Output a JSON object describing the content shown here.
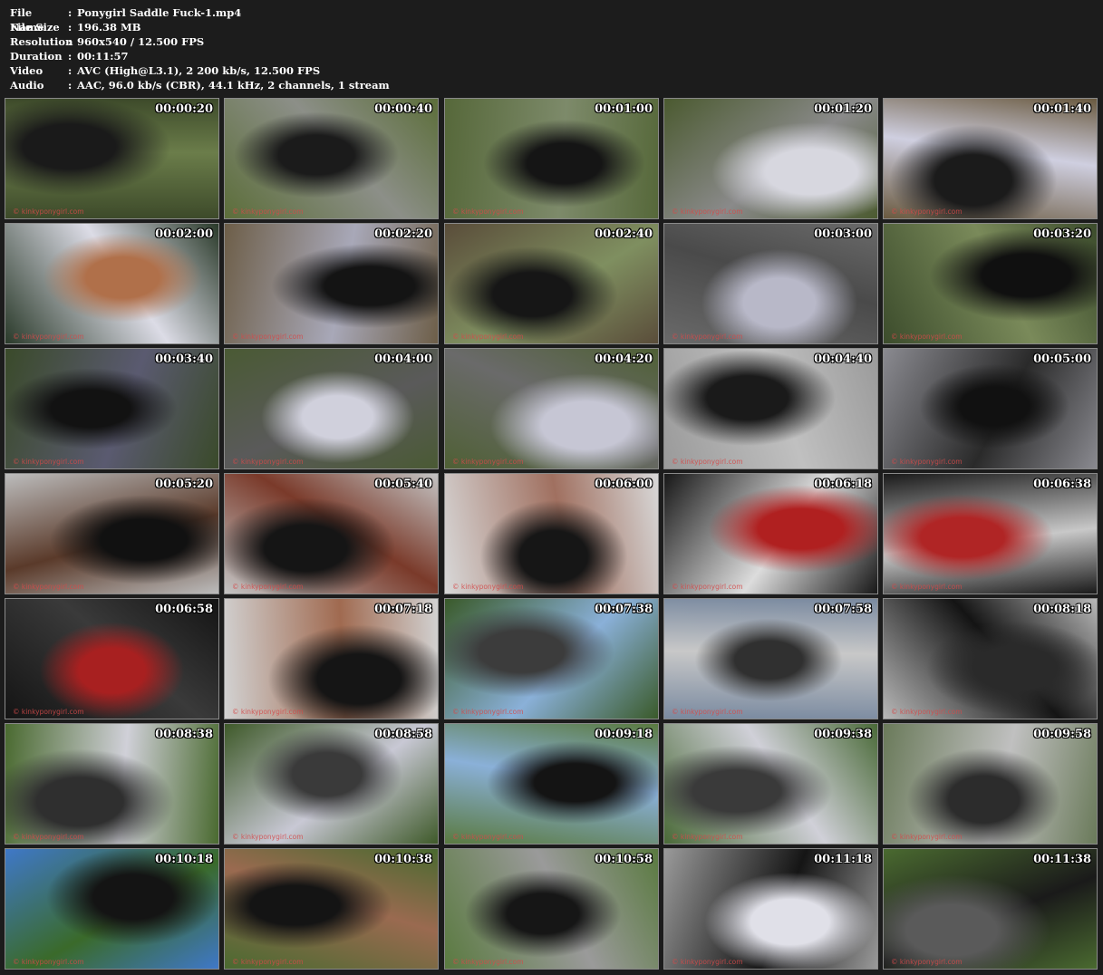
{
  "file_info": {
    "rows": [
      {
        "label": "File Name",
        "sep": ":",
        "value": "Ponygirl Saddle Fuck-1.mp4"
      },
      {
        "label": "File Size",
        "sep": ":",
        "value": "196.38 MB"
      },
      {
        "label": "Resolution",
        "sep": ":",
        "value": "960x540 / 12.500 FPS"
      },
      {
        "label": "Duration",
        "sep": ":",
        "value": "00:11:57"
      },
      {
        "label": "Video",
        "sep": ":",
        "value": "AVC (High@L3.1), 2 200 kb/s, 12.500 FPS"
      },
      {
        "label": "Audio",
        "sep": ":",
        "value": "AAC, 96.0 kb/s (CBR), 44.1 kHz, 2 channels, 1 stream"
      }
    ]
  },
  "watermark": "© kinkyponygirl.com",
  "colors": {
    "background": "#1c1c1c",
    "thumb_border": "#8a8a8a",
    "watermark": "#d44a4a"
  },
  "thumbnails": [
    {
      "time": "00:00:20",
      "palette": [
        "#3d4a2a",
        "#1a1a1a",
        "#6b7d4a"
      ]
    },
    {
      "time": "00:00:40",
      "palette": [
        "#5c6e3a",
        "#1b1b1b",
        "#8c8f88"
      ]
    },
    {
      "time": "00:01:00",
      "palette": [
        "#56683a",
        "#151515",
        "#7d8a6a"
      ]
    },
    {
      "time": "00:01:20",
      "palette": [
        "#4b5a30",
        "#d7d7df",
        "#8a8a8a"
      ]
    },
    {
      "time": "00:01:40",
      "palette": [
        "#6a5a40",
        "#1b1b1b",
        "#cfcfe0"
      ]
    },
    {
      "time": "00:02:00",
      "palette": [
        "#2a3a2a",
        "#b0704a",
        "#dcdce6"
      ]
    },
    {
      "time": "00:02:20",
      "palette": [
        "#6d5e48",
        "#141414",
        "#a8a8b8"
      ]
    },
    {
      "time": "00:02:40",
      "palette": [
        "#5a4d3a",
        "#161616",
        "#7f8f60"
      ]
    },
    {
      "time": "00:03:00",
      "palette": [
        "#6a6a6a",
        "#b8b8c8",
        "#4a4a4a"
      ]
    },
    {
      "time": "00:03:20",
      "palette": [
        "#3c4c2c",
        "#101010",
        "#7a8a5a"
      ]
    },
    {
      "time": "00:03:40",
      "palette": [
        "#3a4a2a",
        "#121212",
        "#5a5a70"
      ]
    },
    {
      "time": "00:04:00",
      "palette": [
        "#4a5a34",
        "#d0d0dc",
        "#5a5a5a"
      ]
    },
    {
      "time": "00:04:20",
      "palette": [
        "#4f6035",
        "#c6c6d4",
        "#6a6a6a"
      ]
    },
    {
      "time": "00:04:40",
      "palette": [
        "#9a9a9a",
        "#1a1a1a",
        "#c0c0c0"
      ]
    },
    {
      "time": "00:05:00",
      "palette": [
        "#8a8a90",
        "#111111",
        "#2a2a2a"
      ]
    },
    {
      "time": "00:05:20",
      "palette": [
        "#bcbcbc",
        "#111111",
        "#5a3a2a"
      ]
    },
    {
      "time": "00:05:40",
      "palette": [
        "#c4c4c4",
        "#151515",
        "#7a3a2a"
      ]
    },
    {
      "time": "00:06:00",
      "palette": [
        "#d8d8d8",
        "#161616",
        "#a07060"
      ]
    },
    {
      "time": "00:06:18",
      "palette": [
        "#181818",
        "#b02020",
        "#dcdcdc"
      ]
    },
    {
      "time": "00:06:38",
      "palette": [
        "#1a1a1a",
        "#b02525",
        "#c8c8c8"
      ]
    },
    {
      "time": "00:06:58",
      "palette": [
        "#141414",
        "#a82020",
        "#3a3a3a"
      ]
    },
    {
      "time": "00:07:18",
      "palette": [
        "#d2d2d2",
        "#151515",
        "#a06a50"
      ]
    },
    {
      "time": "00:07:38",
      "palette": [
        "#3a5a2a",
        "#3c3c3c",
        "#8ab0d8"
      ]
    },
    {
      "time": "00:07:58",
      "palette": [
        "#7a8aa0",
        "#303030",
        "#c8c8c8"
      ]
    },
    {
      "time": "00:08:18",
      "palette": [
        "#b8b8b8",
        "#2a2a2a",
        "#141414"
      ]
    },
    {
      "time": "00:08:38",
      "palette": [
        "#4a6a30",
        "#2f2f2f",
        "#d0d0d8"
      ]
    },
    {
      "time": "00:08:58",
      "palette": [
        "#3f5a2a",
        "#3a3a3a",
        "#c8c8d4"
      ]
    },
    {
      "time": "00:09:18",
      "palette": [
        "#5a7a40",
        "#141414",
        "#8ab0d8"
      ]
    },
    {
      "time": "00:09:38",
      "palette": [
        "#4a6a38",
        "#3a3a3a",
        "#d0d0d8"
      ]
    },
    {
      "time": "00:09:58",
      "palette": [
        "#6a7a5a",
        "#2c2c2c",
        "#c0c0c0"
      ]
    },
    {
      "time": "00:10:18",
      "palette": [
        "#3f78c8",
        "#141414",
        "#3a6a2a"
      ]
    },
    {
      "time": "00:10:38",
      "palette": [
        "#4a6a30",
        "#141414",
        "#9a6a50"
      ]
    },
    {
      "time": "00:10:58",
      "palette": [
        "#5a7a40",
        "#161616",
        "#9a9a9a"
      ]
    },
    {
      "time": "00:11:18",
      "palette": [
        "#9a9a9a",
        "#e0e0e8",
        "#151515"
      ]
    },
    {
      "time": "00:11:38",
      "palette": [
        "#4a6a30",
        "#5a5a5a",
        "#1a1a1a"
      ]
    }
  ]
}
